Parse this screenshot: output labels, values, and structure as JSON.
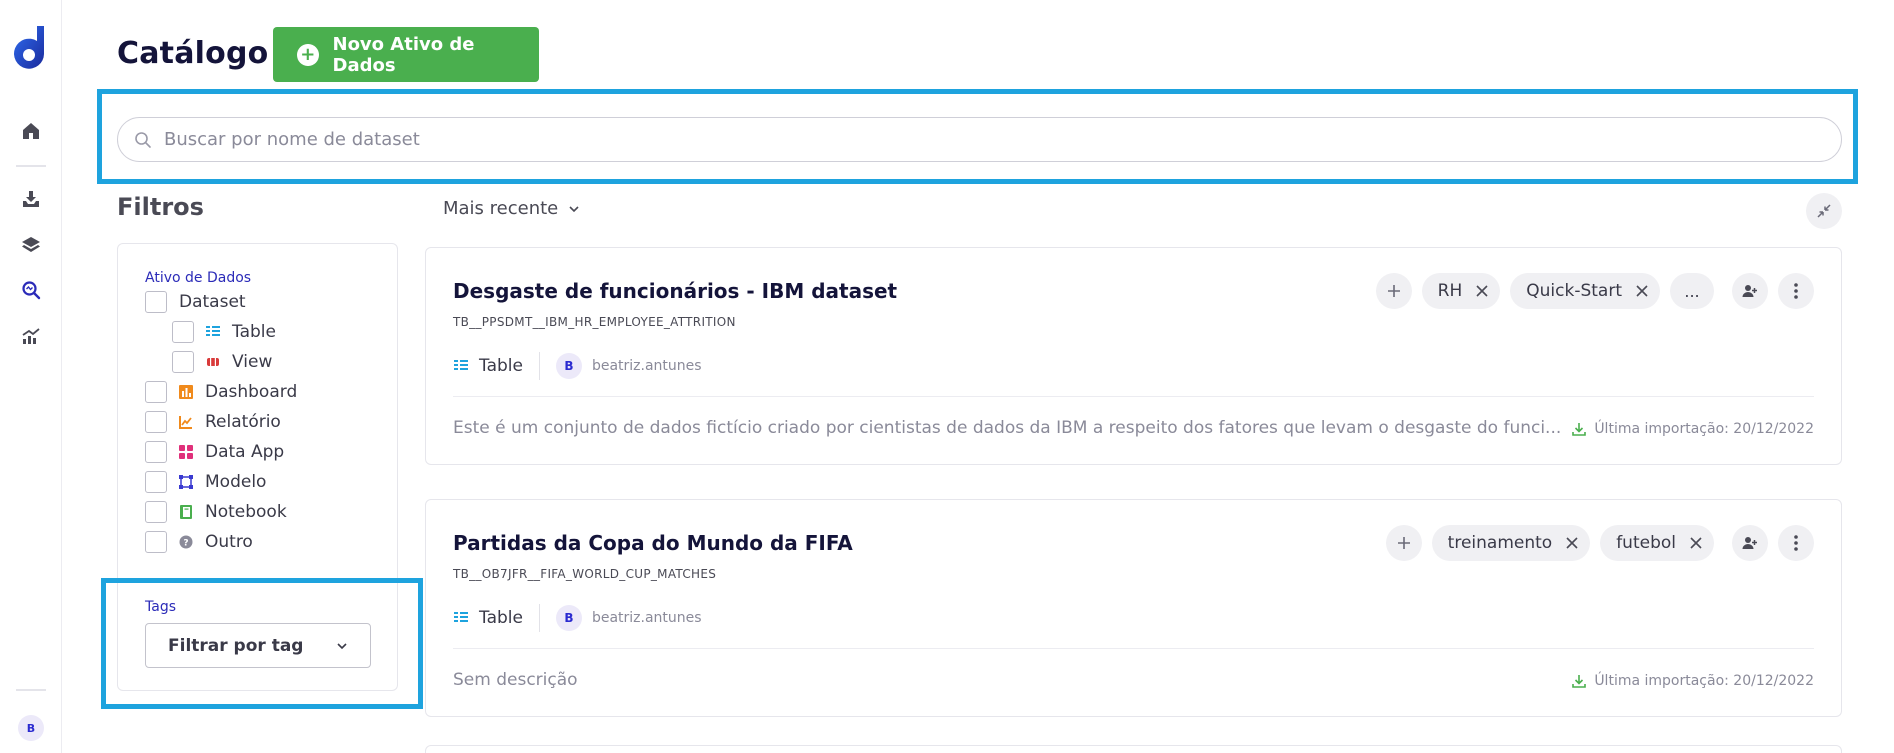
{
  "page": {
    "title": "Catálogo",
    "new_button_label": "Novo Ativo de Dados"
  },
  "search": {
    "placeholder": "Buscar por nome de dataset"
  },
  "filters": {
    "title": "Filtros",
    "asset_group_label": "Ativo de Dados",
    "items": [
      {
        "label": "Dataset",
        "icon": "none"
      },
      {
        "label": "Table",
        "icon": "table-icon",
        "color": "#1ea3de"
      },
      {
        "label": "View",
        "icon": "view-icon",
        "color": "#d93a3a"
      },
      {
        "label": "Dashboard",
        "icon": "dashboard-icon",
        "color": "#f08a1c"
      },
      {
        "label": "Relatório",
        "icon": "report-icon",
        "color": "#f08a1c"
      },
      {
        "label": "Data App",
        "icon": "data-app-icon",
        "color": "#e0307a"
      },
      {
        "label": "Modelo",
        "icon": "model-icon",
        "color": "#3a3ad0"
      },
      {
        "label": "Notebook",
        "icon": "notebook-icon",
        "color": "#4aaf4e"
      },
      {
        "label": "Outro",
        "icon": "other-icon",
        "color": "#8a8a99"
      }
    ],
    "tags_label": "Tags",
    "tag_select": "Filtrar por tag"
  },
  "sort": {
    "label": "Mais recente"
  },
  "cards": [
    {
      "title": "Desgaste de funcionários - IBM dataset",
      "technical_name": "TB__PPSDMT__IBM_HR_EMPLOYEE_ATTRITION",
      "type": "Table",
      "owner_initial": "B",
      "owner": "beatriz.antunes",
      "tags": [
        "RH",
        "Quick-Start"
      ],
      "more": "...",
      "description": "Este é um conjunto de dados fictício criado por cientistas de dados da IBM a respeito dos fatores que levam o desgaste do funci...",
      "import": "Última importação: 20/12/2022"
    },
    {
      "title": "Partidas da Copa do Mundo da FIFA",
      "technical_name": "TB__OB7JFR__FIFA_WORLD_CUP_MATCHES",
      "type": "Table",
      "owner_initial": "B",
      "owner": "beatriz.antunes",
      "tags": [
        "treinamento",
        "futebol"
      ],
      "description": "Sem descrição",
      "import": "Última importação: 20/12/2022"
    }
  ],
  "user": {
    "initial": "B"
  },
  "colors": {
    "accent_green": "#4aaf4e",
    "highlight_blue": "#1ea3de",
    "brand_blue": "#2b2bd0"
  }
}
